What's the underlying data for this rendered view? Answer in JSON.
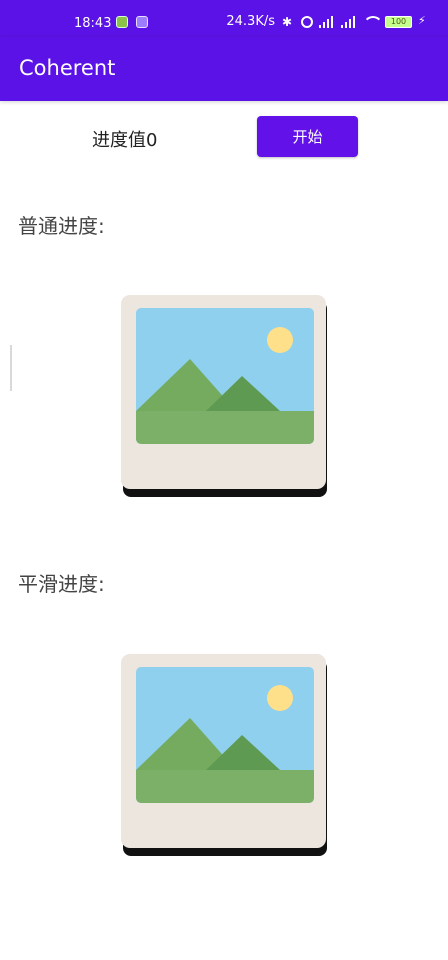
{
  "status_bar": {
    "time": "18:43",
    "speed": "24.3K/s",
    "battery": "100"
  },
  "app": {
    "title": "Coherent"
  },
  "controls": {
    "progress_text": "进度值0",
    "start_button": "开始"
  },
  "sections": {
    "normal_label": "普通进度:",
    "smooth_label": "平滑进度:"
  },
  "icons": {
    "image_placeholder": "image-placeholder-icon",
    "bluetooth": "bluetooth-icon",
    "alarm": "alarm-icon",
    "signal": "signal-icon",
    "wifi": "wifi-icon",
    "battery": "battery-icon",
    "charging": "charging-icon"
  },
  "colors": {
    "primary": "#5b12e6",
    "button": "#6212e8",
    "text": "#222222",
    "secondary_text": "#444444",
    "sky": "#8fd0ee",
    "grass": "#7caf68",
    "sun": "#ffe08a"
  }
}
